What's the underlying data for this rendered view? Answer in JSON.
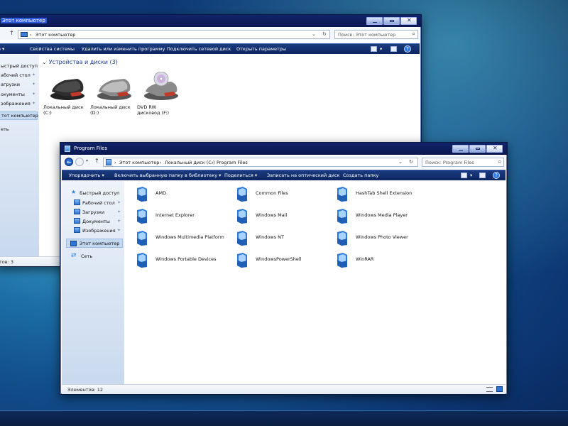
{
  "background": {
    "accent": "#124f8c"
  },
  "window_back": {
    "title": "Этот компьютер",
    "address": "Этот компьютер",
    "search_placeholder": "Поиск: Этот компьютер",
    "commands": [
      "Свойства системы",
      "Удалить или изменить программу",
      "Подключить сетевой диск",
      "Открыть параметры"
    ],
    "nav_items": [
      {
        "label": "ыстрый доступ",
        "pinned": false
      },
      {
        "label": "абочий стол",
        "pinned": true
      },
      {
        "label": "агрузки",
        "pinned": true
      },
      {
        "label": "окументы",
        "pinned": true
      },
      {
        "label": "зображения",
        "pinned": true
      },
      {
        "label": "тот компьютер",
        "pinned": false
      },
      {
        "label": "еть",
        "pinned": false
      }
    ],
    "group_title": "Устройства и диски (3)",
    "drives": [
      {
        "line1": "Локальный диск",
        "line2": "(C:)"
      },
      {
        "line1": "Локальный диск",
        "line2": "(D:)"
      },
      {
        "line1": "DVD RW",
        "line2": "дисковод (F:)"
      }
    ],
    "status": "тов: 3"
  },
  "window_front": {
    "title": "Program Files",
    "breadcrumbs": [
      "Этот компьютер",
      "Локальный диск (C:)",
      "Program Files"
    ],
    "search_placeholder": "Поиск: Program Files",
    "commands": [
      "Упорядочить ▾",
      "Включить выбранную папку в библиотеку ▾",
      "Поделиться ▾",
      "Записать на оптический диск",
      "Создать папку"
    ],
    "nav": {
      "quick_access": "Быстрый доступ",
      "desktop": "Рабочий стол",
      "downloads": "Загрузки",
      "documents": "Документы",
      "images": "Изображения",
      "this_pc": "Этот компьютер",
      "network": "Сеть"
    },
    "folders": [
      "AMD",
      "Common Files",
      "HashTab Shell Extension",
      "Internet Explorer",
      "Windows Mail",
      "Windows Media Player",
      "Windows Multimedia Platform",
      "Windows NT",
      "Windows Photo Viewer",
      "Windows Portable Devices",
      "WindowsPowerShell",
      "WinRAR"
    ],
    "status": "Элементов: 12"
  }
}
